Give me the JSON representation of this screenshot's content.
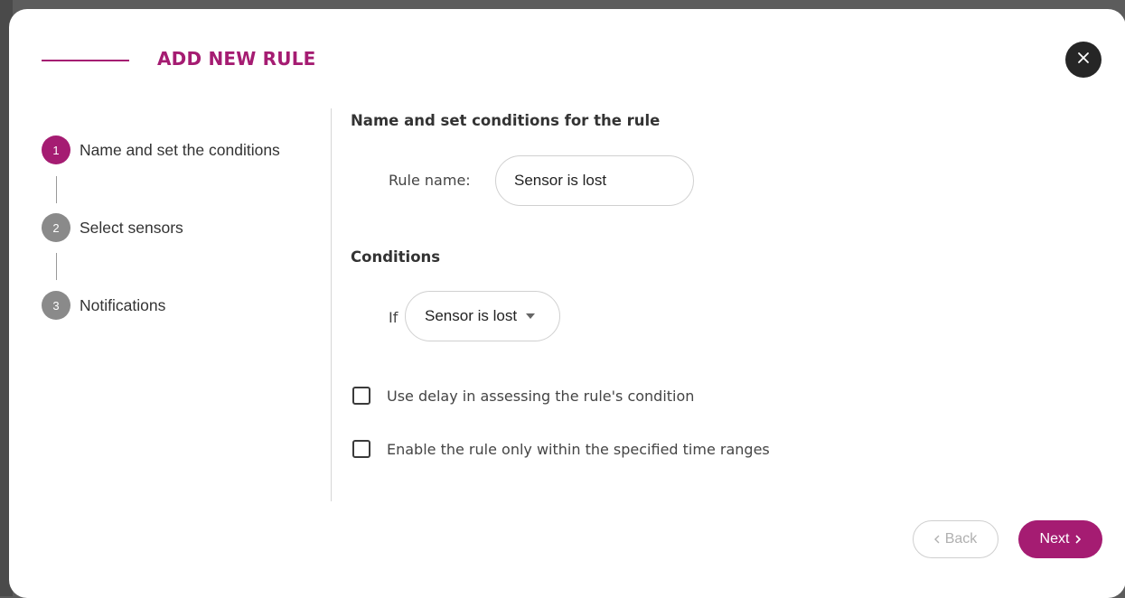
{
  "modal": {
    "title": "ADD NEW RULE",
    "close_icon": "close-icon"
  },
  "steps": [
    {
      "number": "1",
      "label": "Name and set the conditions",
      "state": "active"
    },
    {
      "number": "2",
      "label": "Select sensors",
      "state": "inactive"
    },
    {
      "number": "3",
      "label": "Notifications",
      "state": "inactive"
    }
  ],
  "form": {
    "heading": "Name and set conditions for the rule",
    "rule_name_label": "Rule name:",
    "rule_name_value": "Sensor is lost",
    "conditions_heading": "Conditions",
    "if_label": "If",
    "condition_selected": "Sensor is lost",
    "checkboxes": [
      {
        "label": "Use delay in assessing the rule's condition",
        "checked": false
      },
      {
        "label": "Enable the rule only within the specified time ranges",
        "checked": false
      }
    ]
  },
  "footer": {
    "back_label": "Back",
    "back_enabled": false,
    "next_label": "Next"
  },
  "colors": {
    "accent": "#a51c72",
    "inactive_step": "#8a8a8a",
    "close_button": "#262626"
  }
}
